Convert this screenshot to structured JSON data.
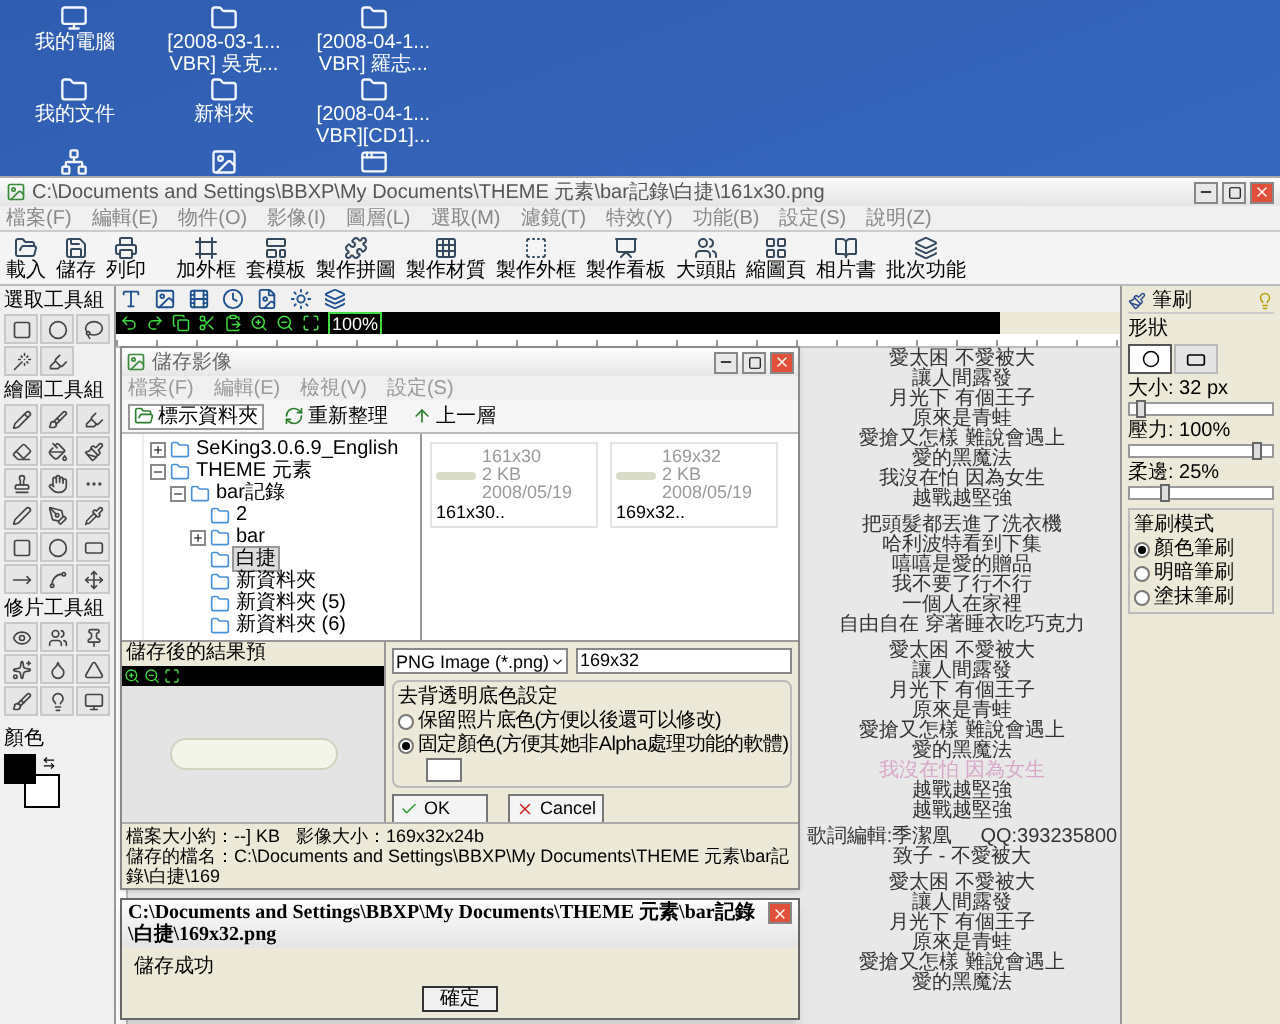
{
  "desktop": {
    "icons": [
      {
        "kind": "computer",
        "label": "我的電腦"
      },
      {
        "kind": "folder",
        "label": "[2008-03-1... VBR] 吳克..."
      },
      {
        "kind": "folder",
        "label": "[2008-04-1... VBR] 羅志..."
      },
      {
        "kind": "folder",
        "label": "我的文件"
      },
      {
        "kind": "folder",
        "label": "新料夾"
      },
      {
        "kind": "folder",
        "label": "[2008-04-1... VBR][CD1]..."
      },
      {
        "kind": "network"
      },
      {
        "kind": "image"
      },
      {
        "kind": "app"
      }
    ]
  },
  "main_window": {
    "title": "C:\\Documents and Settings\\BBXP\\My Documents\\THEME 元素\\bar記錄\\白捷\\161x30.png",
    "menu": [
      "檔案(F)",
      "編輯(E)",
      "物件(O)",
      "影像(I)",
      "圖層(L)",
      "選取(M)",
      "濾鏡(T)",
      "特效(Y)",
      "功能(B)",
      "設定(S)",
      "說明(Z)"
    ],
    "toolbar": [
      "載入",
      "儲存",
      "列印",
      "加外框",
      "套模板",
      "製作拼圖",
      "製作材質",
      "製作外框",
      "製作看板",
      "大頭貼",
      "縮圖頁",
      "相片書",
      "批次功能"
    ],
    "tool_groups": [
      "選取工具組",
      "繪圖工具組",
      "修片工具組"
    ],
    "color_label": "顏色",
    "zoom": "100%",
    "brush_panel": {
      "title": "筆刷",
      "shape_label": "形狀",
      "shapes": [
        {
          "kind": "circle",
          "selected": true
        },
        {
          "kind": "rectangle",
          "selected": false
        }
      ],
      "sliders": [
        {
          "label": "大小: 32 px",
          "level": 0.08
        },
        {
          "label": "壓力: 100%",
          "level": 0.9
        },
        {
          "label": "柔邊: 25%",
          "level": 0.25
        }
      ],
      "mode_title": "筆刷模式",
      "modes": [
        {
          "label": "顏色筆刷",
          "selected": true
        },
        {
          "label": "明暗筆刷",
          "selected": false
        },
        {
          "label": "塗抹筆刷",
          "selected": false
        }
      ]
    },
    "lyrics": [
      {
        "lines": [
          {
            "text": "愛太困 不愛被大",
            "faded": false
          },
          {
            "text": "讓人間露發",
            "faded": false
          },
          {
            "text": "月光下 有個王子",
            "faded": false
          },
          {
            "text": "原來是青蛙",
            "faded": false
          },
          {
            "text": "愛搶又怎樣 難說會遇上",
            "faded": false
          },
          {
            "text": "愛的黑魔法",
            "faded": false
          },
          {
            "text": "我沒在怕 因為女生",
            "faded": false
          },
          {
            "text": "越戰越堅強",
            "faded": false
          }
        ]
      },
      {
        "lines": [
          {
            "text": "把頭髮都丟進了洗衣機",
            "faded": false
          },
          {
            "text": "哈利波特看到下集",
            "faded": false
          },
          {
            "text": "嘻嘻是愛的贈品",
            "faded": false
          },
          {
            "text": "我不要了行不行",
            "faded": false
          },
          {
            "text": "一個人在家裡",
            "faded": false
          },
          {
            "text": "自由自在 穿著睡衣吃巧克力",
            "faded": false
          }
        ]
      },
      {
        "lines": [
          {
            "text": "愛太困 不愛被大",
            "faded": false
          },
          {
            "text": "讓人間露發",
            "faded": false
          },
          {
            "text": "月光下 有個王子",
            "faded": false
          },
          {
            "text": "原來是青蛙",
            "faded": false
          },
          {
            "text": "愛搶又怎樣 難說會遇上",
            "faded": false
          },
          {
            "text": "愛的黑魔法",
            "faded": false
          },
          {
            "text": "我沒在怕 因為女生",
            "faded": true
          },
          {
            "text": "越戰越堅強",
            "faded": false
          },
          {
            "text": "越戰越堅強",
            "faded": false
          }
        ]
      },
      {
        "lines": [
          {
            "text": "歌詞編輯:季潔凰",
            "extra": "QQ:393235800",
            "faded": false
          },
          {
            "text": "致子 - 不愛被大",
            "faded": false
          }
        ]
      },
      {
        "lines": [
          {
            "text": "愛太困 不愛被大",
            "faded": false
          },
          {
            "text": "讓人間露發",
            "faded": false
          },
          {
            "text": "月光下 有個王子",
            "faded": false
          },
          {
            "text": "原來是青蛙",
            "faded": false
          },
          {
            "text": "愛搶又怎樣 難說會遇上",
            "faded": false
          },
          {
            "text": "愛的黑魔法",
            "faded": false
          }
        ]
      }
    ]
  },
  "save_dialog": {
    "title": "儲存影像",
    "menu": [
      "檔案(F)",
      "編輯(E)",
      "檢視(V)",
      "設定(S)"
    ],
    "toolbar": [
      "標示資料夾",
      "重新整理",
      "上一層"
    ],
    "tree": [
      {
        "label": "SeKing3.0.6.9_English",
        "expanded": false,
        "selected": false
      },
      {
        "label": "THEME 元素",
        "expanded": true,
        "selected": false,
        "children": [
          {
            "label": "bar記錄",
            "expanded": true,
            "selected": false,
            "children": [
              {
                "label": "2",
                "selected": false
              },
              {
                "label": "bar",
                "expanded": false,
                "selected": false
              },
              {
                "label": "白捷",
                "selected": true
              },
              {
                "label": "新資料夾",
                "selected": false
              },
              {
                "label": "新資料夾 (5)",
                "selected": false
              },
              {
                "label": "新資料夾 (6)",
                "selected": false
              }
            ]
          }
        ]
      }
    ],
    "files": [
      {
        "name": "161x30",
        "size": "2 KB",
        "date": "2008/05/19",
        "caption": "161x30.."
      },
      {
        "name": "169x32",
        "size": "2 KB",
        "date": "2008/05/19",
        "caption": "169x32.."
      }
    ],
    "preview_label": "儲存後的結果預",
    "format": "PNG Image (*.png)",
    "filename": "169x32",
    "transparency_title": "去背透明底色設定",
    "transparency_options": [
      {
        "label": "保留照片底色(方便以後還可以修改)",
        "selected": false
      },
      {
        "label": "固定顏色(方便其她非Alpha處理功能的軟體)",
        "selected": true
      }
    ],
    "ok": "OK",
    "cancel": "Cancel",
    "status": [
      "檔案大小約：--] KB",
      "影像大小：169x32x24b",
      "儲存的檔名：C:\\Documents and Settings\\BBXP\\My Documents\\THEME 元素\\bar記錄\\白捷\\169"
    ]
  },
  "message_box": {
    "title": "C:\\Documents and Settings\\BBXP\\My Documents\\THEME 元素\\bar記錄\\白捷\\169x32.png",
    "message": "儲存成功",
    "button": "確定"
  }
}
